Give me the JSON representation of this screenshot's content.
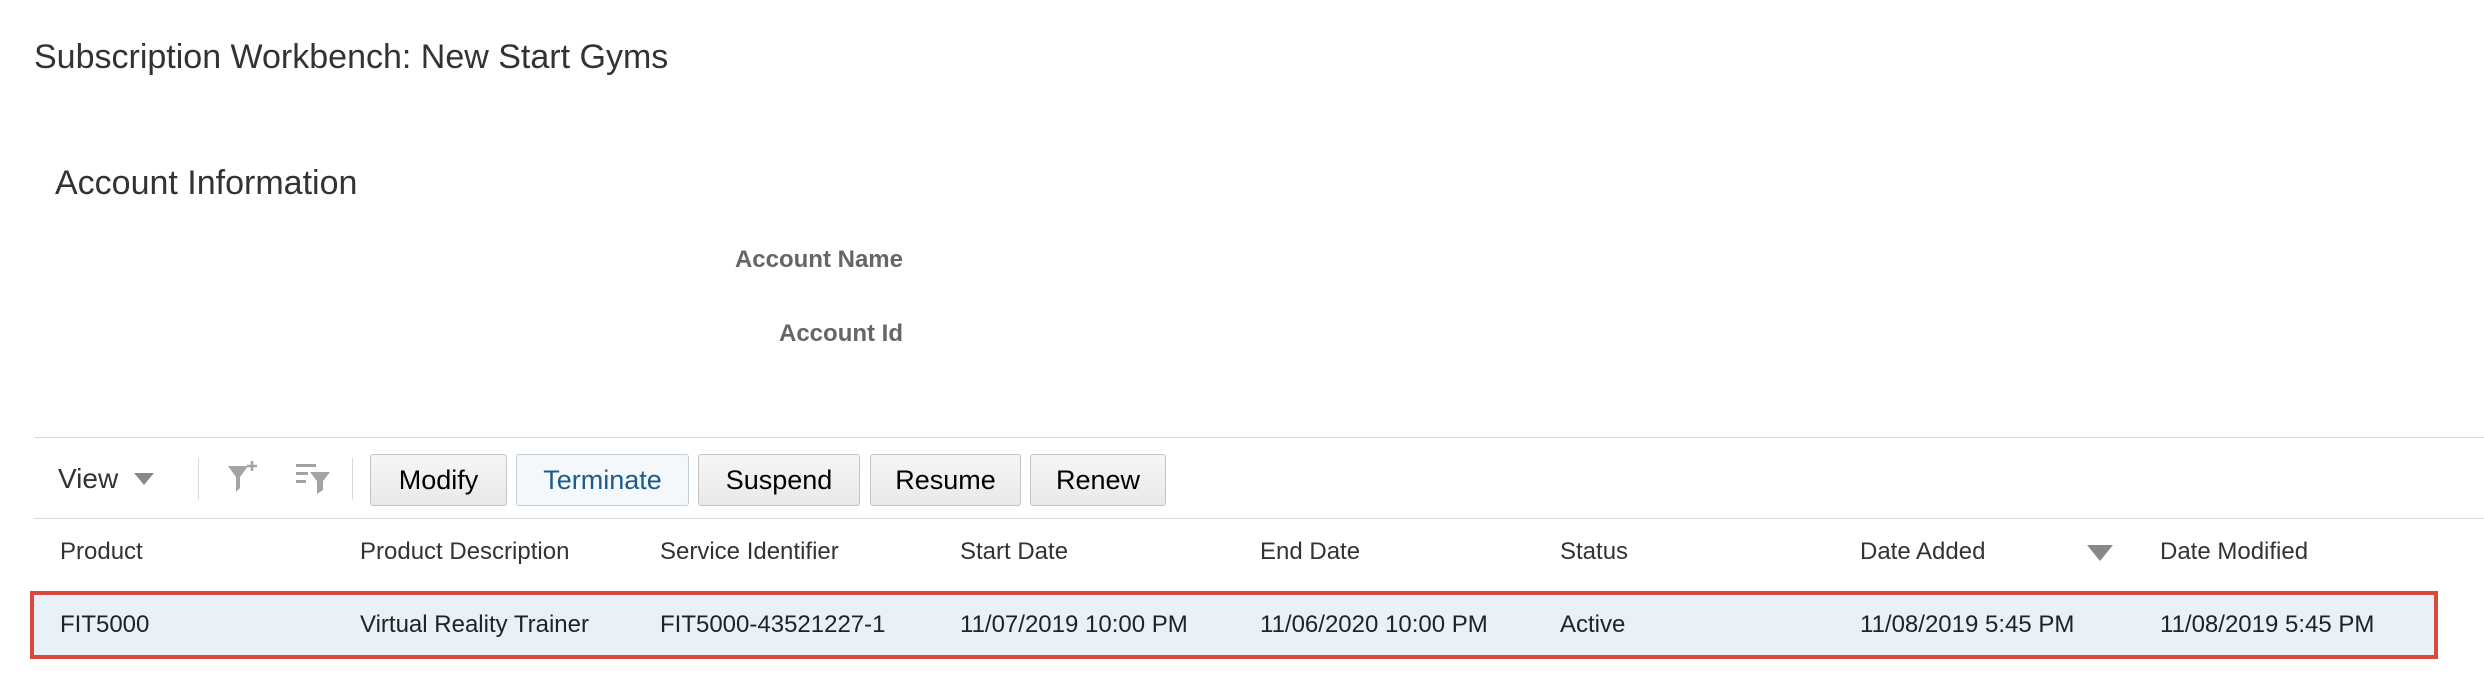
{
  "page": {
    "title": "Subscription Workbench: New Start Gyms"
  },
  "account_info": {
    "section_title": "Account Information",
    "fields": [
      {
        "label": "Account Name",
        "value": ""
      },
      {
        "label": "Account Id",
        "value": ""
      }
    ]
  },
  "toolbar": {
    "view_label": "View",
    "icons": [
      "add-filter-icon",
      "filter-row-icon"
    ],
    "buttons": [
      "Modify",
      "Terminate",
      "Suspend",
      "Resume",
      "Renew"
    ],
    "highlighted_button": "Terminate"
  },
  "table": {
    "columns": [
      "Product",
      "Product Description",
      "Service Identifier",
      "Start Date",
      "End Date",
      "Status",
      "Date Added",
      "Date Modified"
    ],
    "sort": {
      "column": "Date Added",
      "direction": "descending"
    },
    "rows": [
      [
        "FIT5000",
        "Virtual Reality Trainer",
        "FIT5000-43521227-1",
        "11/07/2019 10:00 PM",
        "11/06/2020 10:00 PM",
        "Active",
        "11/08/2019 5:45 PM",
        "11/08/2019 5:45 PM"
      ]
    ],
    "selected_row": 0
  },
  "colors": {
    "selection_outline": "#d94a3c",
    "selected_row_background": "#e8f0f8",
    "link_blue": "#1b5c8f"
  }
}
